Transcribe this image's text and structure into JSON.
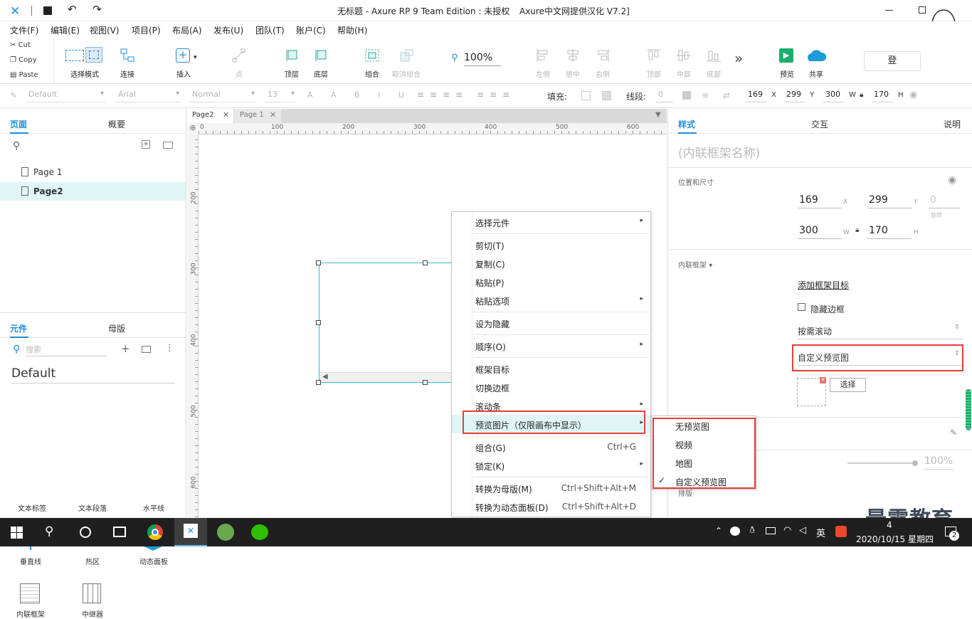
{
  "titlebar": {
    "title": "无标题 - Axure RP 9 Team Edition : 未授权",
    "subtitle": "Axure中文网提供汉化 V7.2]"
  },
  "menu": [
    "文件(F)",
    "编辑(E)",
    "视图(V)",
    "项目(P)",
    "布局(A)",
    "发布(U)",
    "团队(T)",
    "账户(C)",
    "帮助(H)"
  ],
  "clipboard": {
    "cut": "Cut",
    "copy": "Copy",
    "paste": "Paste"
  },
  "toolbar": {
    "select_mode": "选择模式",
    "connect": "连接",
    "insert": "插入",
    "point": "点",
    "top": "顶层",
    "bottom": "底层",
    "group": "组合",
    "ungroup": "取消组合",
    "zoom": "100%",
    "left": "左侧",
    "center": "居中",
    "right": "右侧",
    "top_align": "顶部",
    "middle": "中部",
    "bottom_align": "底部",
    "more": "»",
    "preview": "预览",
    "share": "共享",
    "login": "登"
  },
  "format": {
    "style": "Default",
    "font": "Arial",
    "weight": "Normal",
    "size": "13",
    "fill_label": "填充:",
    "line_label": "线段:",
    "line_value": "0",
    "x": "169",
    "x_l": "X",
    "y": "299",
    "y_l": "Y",
    "w": "300",
    "w_l": "W",
    "h": "170",
    "h_l": "H"
  },
  "leftpanel": {
    "tab_pages": "页面",
    "tab_outline": "概要",
    "pages": [
      "Page 1",
      "Page2"
    ],
    "tab_widgets": "元件",
    "tab_masters": "母版",
    "search_placeholder": "搜索",
    "library": "Default",
    "widgets_row0": [
      "文本标签",
      "文本段落",
      "水平线"
    ],
    "widgets_row1": [
      "垂直线",
      "热区",
      "动态面板"
    ],
    "widgets_row2": [
      "内联框架",
      "中继器"
    ]
  },
  "canvas": {
    "tabs": [
      "Page2",
      "Page 1"
    ],
    "ruler_h": [
      "0",
      "100",
      "200",
      "300",
      "400",
      "500",
      "600"
    ],
    "ruler_v": [
      "200",
      "300",
      "400",
      "500",
      "600"
    ]
  },
  "context_menu": {
    "items": [
      {
        "label": "选择元件",
        "key": "",
        "sub": "▸"
      },
      {
        "label": "剪切(T)",
        "key": "",
        "sub": ""
      },
      {
        "label": "复制(C)",
        "key": "",
        "sub": ""
      },
      {
        "label": "粘贴(P)",
        "key": "",
        "sub": ""
      },
      {
        "label": "粘贴选项",
        "key": "",
        "sub": "▸"
      },
      {
        "label": "设为隐藏",
        "key": "",
        "sub": ""
      },
      {
        "label": "顺序(O)",
        "key": "",
        "sub": "▸"
      },
      {
        "label": "框架目标",
        "key": "",
        "sub": ""
      },
      {
        "label": "切换边框",
        "key": "",
        "sub": ""
      },
      {
        "label": "滚动条",
        "key": "",
        "sub": "▸"
      },
      {
        "label": "预览图片（仅限画布中显示）",
        "key": "",
        "sub": "▸"
      },
      {
        "label": "组合(G)",
        "key": "Ctrl+G",
        "sub": ""
      },
      {
        "label": "锁定(K)",
        "key": "",
        "sub": "▸"
      },
      {
        "label": "转换为母版(M)",
        "key": "Ctrl+Shift+Alt+M",
        "sub": ""
      },
      {
        "label": "转换为动态面板(D)",
        "key": "Ctrl+Shift+Alt+D",
        "sub": ""
      }
    ],
    "submenu": [
      "无预览图",
      "视频",
      "地图",
      "自定义预览图"
    ],
    "checkmark": "✓"
  },
  "rightpanel": {
    "tab_style": "样式",
    "tab_interact": "交互",
    "tab_notes": "说明",
    "name_placeholder": "(内联框架名称)",
    "pos_size": "位置和尺寸",
    "x": "169",
    "x_l": "X",
    "y": "299",
    "y_l": "Y",
    "rot": "0",
    "rot_l": "旋转",
    "w": "300",
    "w_l": "W",
    "h": "170",
    "h_l": "H",
    "inline_frame": "内联框架 ▾",
    "add_target": "添加框架目标",
    "hide_border": "隐藏边框",
    "scroll": "按需滚动",
    "preview": "自定义预览图",
    "choose": "选择",
    "opacity": "100%",
    "arrange": "排版"
  },
  "watermark": "最需教育",
  "taskbar": {
    "time": "4",
    "date": "2020/10/15 星期四",
    "ime": "英",
    "badge": "2"
  }
}
